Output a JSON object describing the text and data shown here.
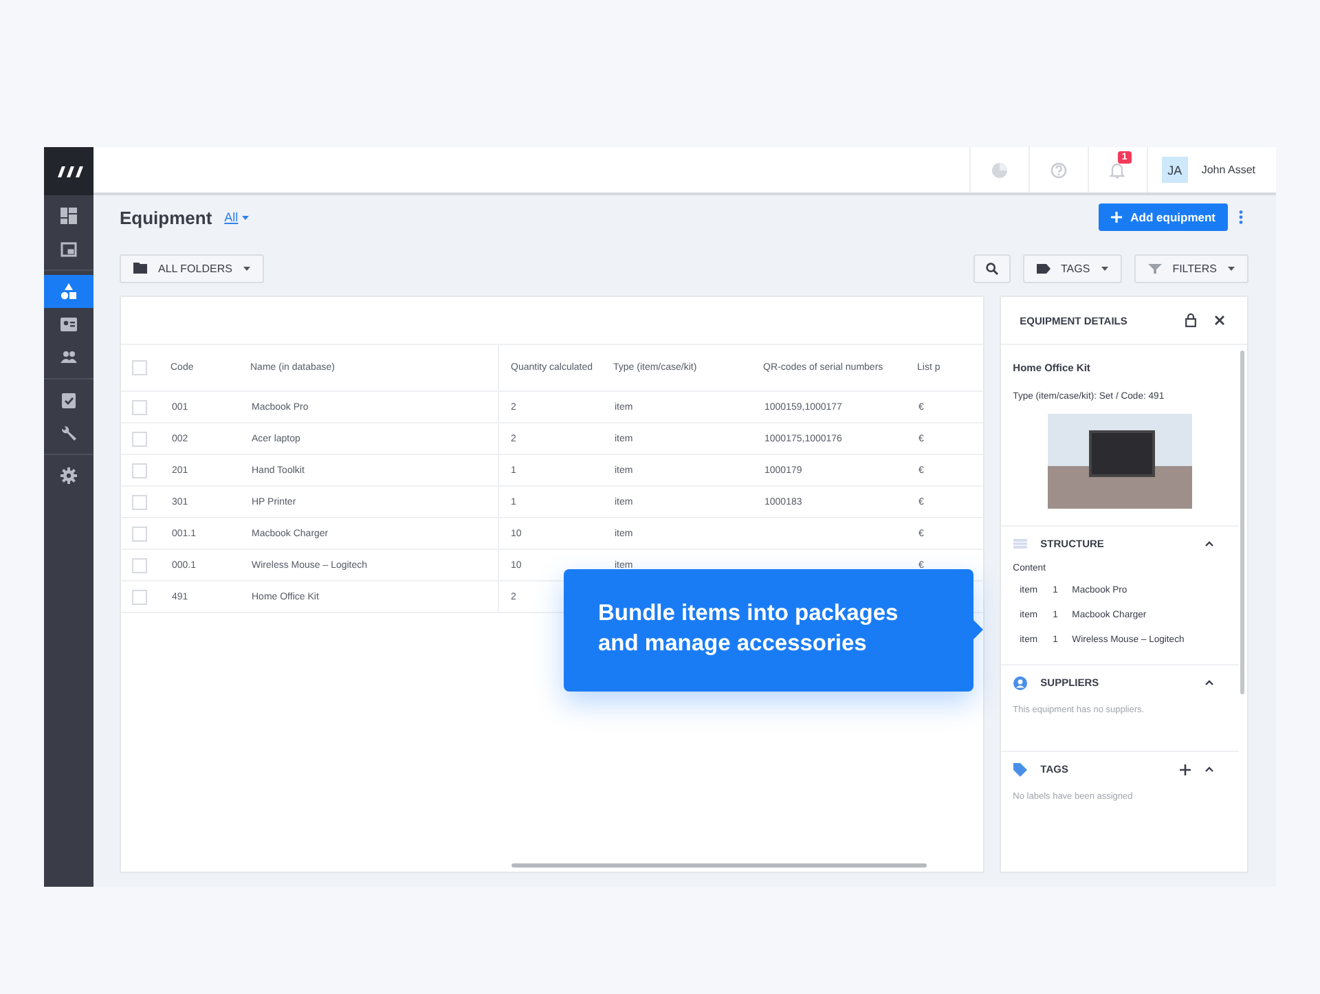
{
  "sidebar": {
    "groups": [
      {
        "items": [
          {
            "selected": false
          },
          {
            "selected": false
          }
        ]
      },
      {
        "items": [
          {
            "selected": true
          },
          {
            "selected": false
          },
          {
            "selected": false
          }
        ]
      },
      {
        "items": [
          {
            "selected": false
          },
          {
            "selected": false
          }
        ]
      },
      {
        "items": [
          {
            "selected": false
          }
        ]
      }
    ]
  },
  "topbar": {
    "notification_count": "1",
    "user_initials": "JA",
    "user_name": "John Asset"
  },
  "header": {
    "title": "Equipment",
    "view_filter": "All",
    "add_button": "Add equipment"
  },
  "toolbar": {
    "folders": "ALL FOLDERS",
    "tags": "TAGS",
    "filters": "FILTERS"
  },
  "table": {
    "all_checked": false,
    "columns": [
      "Code",
      "Name (in database)",
      "Quantity calculated",
      "Type (item/case/kit)",
      "QR-codes of serial numbers",
      "List p"
    ],
    "rows": [
      {
        "checked": false,
        "code": "001",
        "name": "Macbook Pro",
        "quantity": "2",
        "type": "item",
        "qr_codes": "1000159,1000177",
        "list_price": "€"
      },
      {
        "checked": false,
        "code": "002",
        "name": "Acer laptop",
        "quantity": "2",
        "type": "item",
        "qr_codes": "1000175,1000176",
        "list_price": "€"
      },
      {
        "checked": false,
        "code": "201",
        "name": "Hand Toolkit",
        "quantity": "1",
        "type": "item",
        "qr_codes": "1000179",
        "list_price": "€"
      },
      {
        "checked": false,
        "code": "301",
        "name": "HP Printer",
        "quantity": "1",
        "type": "item",
        "qr_codes": "1000183",
        "list_price": "€"
      },
      {
        "checked": false,
        "code": "001.1",
        "name": "Macbook Charger",
        "quantity": "10",
        "type": "item",
        "list_price": "€"
      },
      {
        "checked": false,
        "code": "000.1",
        "name": "Wireless Mouse – Logitech",
        "quantity": "10",
        "type": "item",
        "list_price": "€"
      },
      {
        "checked": false,
        "code": "491",
        "name": "Home Office Kit",
        "quantity": "2"
      }
    ]
  },
  "details": {
    "title": "EQUIPMENT DETAILS",
    "name": "Home Office Kit",
    "meta": "Type (item/case/kit): Set / Code: 491",
    "structure": {
      "title": "STRUCTURE",
      "expanded": true,
      "content_label": "Content",
      "items": [
        {
          "type": "item",
          "quantity": "1",
          "name": "Macbook Pro"
        },
        {
          "type": "item",
          "quantity": "1",
          "name": "Macbook Charger"
        },
        {
          "type": "item",
          "quantity": "1",
          "name": "Wireless Mouse – Logitech"
        }
      ]
    },
    "suppliers": {
      "title": "SUPPLIERS",
      "expanded": true,
      "empty_text": "This equipment has no suppliers."
    },
    "tags": {
      "title": "TAGS",
      "expanded": true,
      "empty_text": "No labels have been assigned"
    }
  },
  "tooltip": {
    "text": "Bundle items into packages and manage accessories"
  }
}
